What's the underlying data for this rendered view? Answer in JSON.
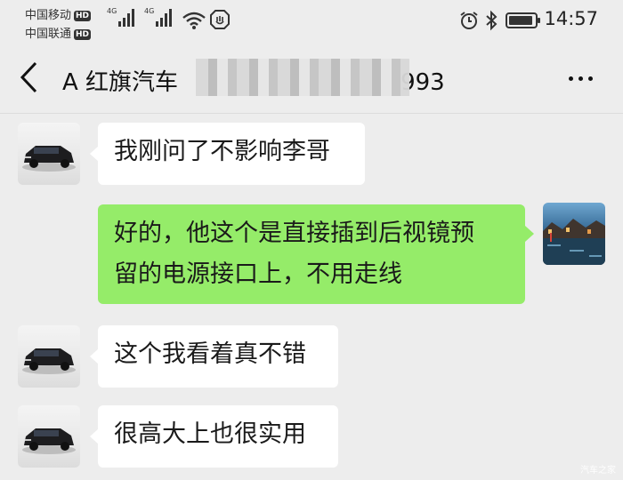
{
  "status_bar": {
    "carrier_1": "中国移动",
    "carrier_2": "中国联通",
    "hd_badge": "HD",
    "network_1": "4G",
    "network_2": "4G",
    "time": "14:57",
    "icons": [
      "signal-bars-icon",
      "wifi-icon",
      "shield-icon",
      "alarm-icon",
      "bluetooth-icon",
      "battery-icon"
    ]
  },
  "header": {
    "title": "A 红旗汽车",
    "title_suffix": "993",
    "back_icon": "chevron-left-icon",
    "more_icon": "more-dots-icon"
  },
  "messages": [
    {
      "side": "in",
      "avatar": "car-avatar",
      "text": "我刚问了不影响李哥"
    },
    {
      "side": "out",
      "avatar": "waterside-town-avatar",
      "lines": [
        "好的，他这个是直接插到后视镜预",
        "留的电源接口上，不用走线"
      ]
    },
    {
      "side": "in",
      "avatar": "car-avatar",
      "text": "这个我看着真不错"
    },
    {
      "side": "in",
      "avatar": "car-avatar",
      "text": "很高大上也很实用"
    }
  ],
  "colors": {
    "background": "#ededed",
    "incoming_bubble": "#ffffff",
    "outgoing_bubble": "#95ec69"
  },
  "watermark": "汽车之家"
}
